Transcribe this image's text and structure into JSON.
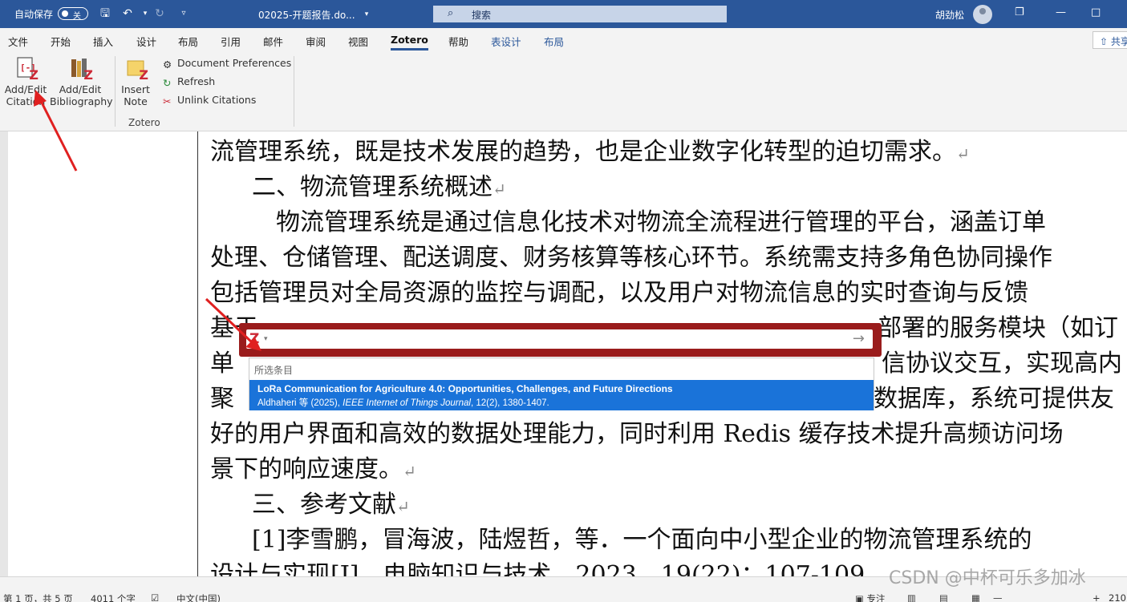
{
  "titlebar": {
    "autosave_label": "自动保存",
    "autosave_state": "关",
    "doc_name": "02025-开题报告.do...",
    "search_placeholder": "搜索",
    "user_name": "胡劲松"
  },
  "ribbon_tabs": [
    "文件",
    "开始",
    "插入",
    "设计",
    "布局",
    "引用",
    "邮件",
    "审阅",
    "视图",
    "Zotero",
    "帮助",
    "表设计",
    "布局"
  ],
  "active_tab": "Zotero",
  "share_label": "共享",
  "zotero_group": {
    "add_edit_citation": [
      "Add/Edit",
      "Citation"
    ],
    "add_edit_bibliography": [
      "Add/Edit",
      "Bibliography"
    ],
    "insert_note": [
      "Insert",
      "Note"
    ],
    "document_preferences": "Document Preferences",
    "refresh": "Refresh",
    "unlink_citations": "Unlink Citations",
    "group_label": "Zotero"
  },
  "document": {
    "lines": [
      "流管理系统，既是技术发展的趋势，也是企业数字化转型的迫切需求。",
      "二、物流管理系统概述",
      "物流管理系统是通过信息化技术对物流全流程进行管理的平台，涵盖订单",
      "处理、仓储管理、配送调度、财务核算等核心环节。系统需支持多角色协同操作",
      "包括管理员对全局资源的监控与调配，以及用户对物流信息的实时查询与反馈",
      "基于",
      "部署的服务模块（如订",
      "单",
      "信协议交互，实现高内",
      "聚",
      "数据库，系统可提供友",
      "好的用户界面和高效的数据处理能力，同时利用 Redis 缓存技术提升高频访问场",
      "景下的响应速度。",
      "三、参考文献",
      "[1]李雪鹏，冒海波，陆煜哲，等．一个面向中小型企业的物流管理系统的",
      "设计与实现[J]．电脑知识与技术，2023，19(22)：107-109．"
    ]
  },
  "zotero_popup": {
    "selected_header": "所选条目",
    "item_title": "LoRa Communication for Agriculture 4.0: Opportunities, Challenges, and Future Directions",
    "item_authors": "Aldhaheri 等 (2025), ",
    "item_journal": "IEEE Internet of Things Journal",
    "item_details": ", 12(2), 1380-1407."
  },
  "statusbar": {
    "page": "第 1 页，共 5 页",
    "words": "4011 个字",
    "language": "中文(中国)",
    "focus": "专注",
    "zoom": "210"
  },
  "watermark": "CSDN @中杯可乐多加冰",
  "colors": {
    "title_blue": "#2b579a",
    "zotero_red": "#9a1c1c",
    "selection_blue": "#1a73d9",
    "arrow_red": "#e02020"
  }
}
